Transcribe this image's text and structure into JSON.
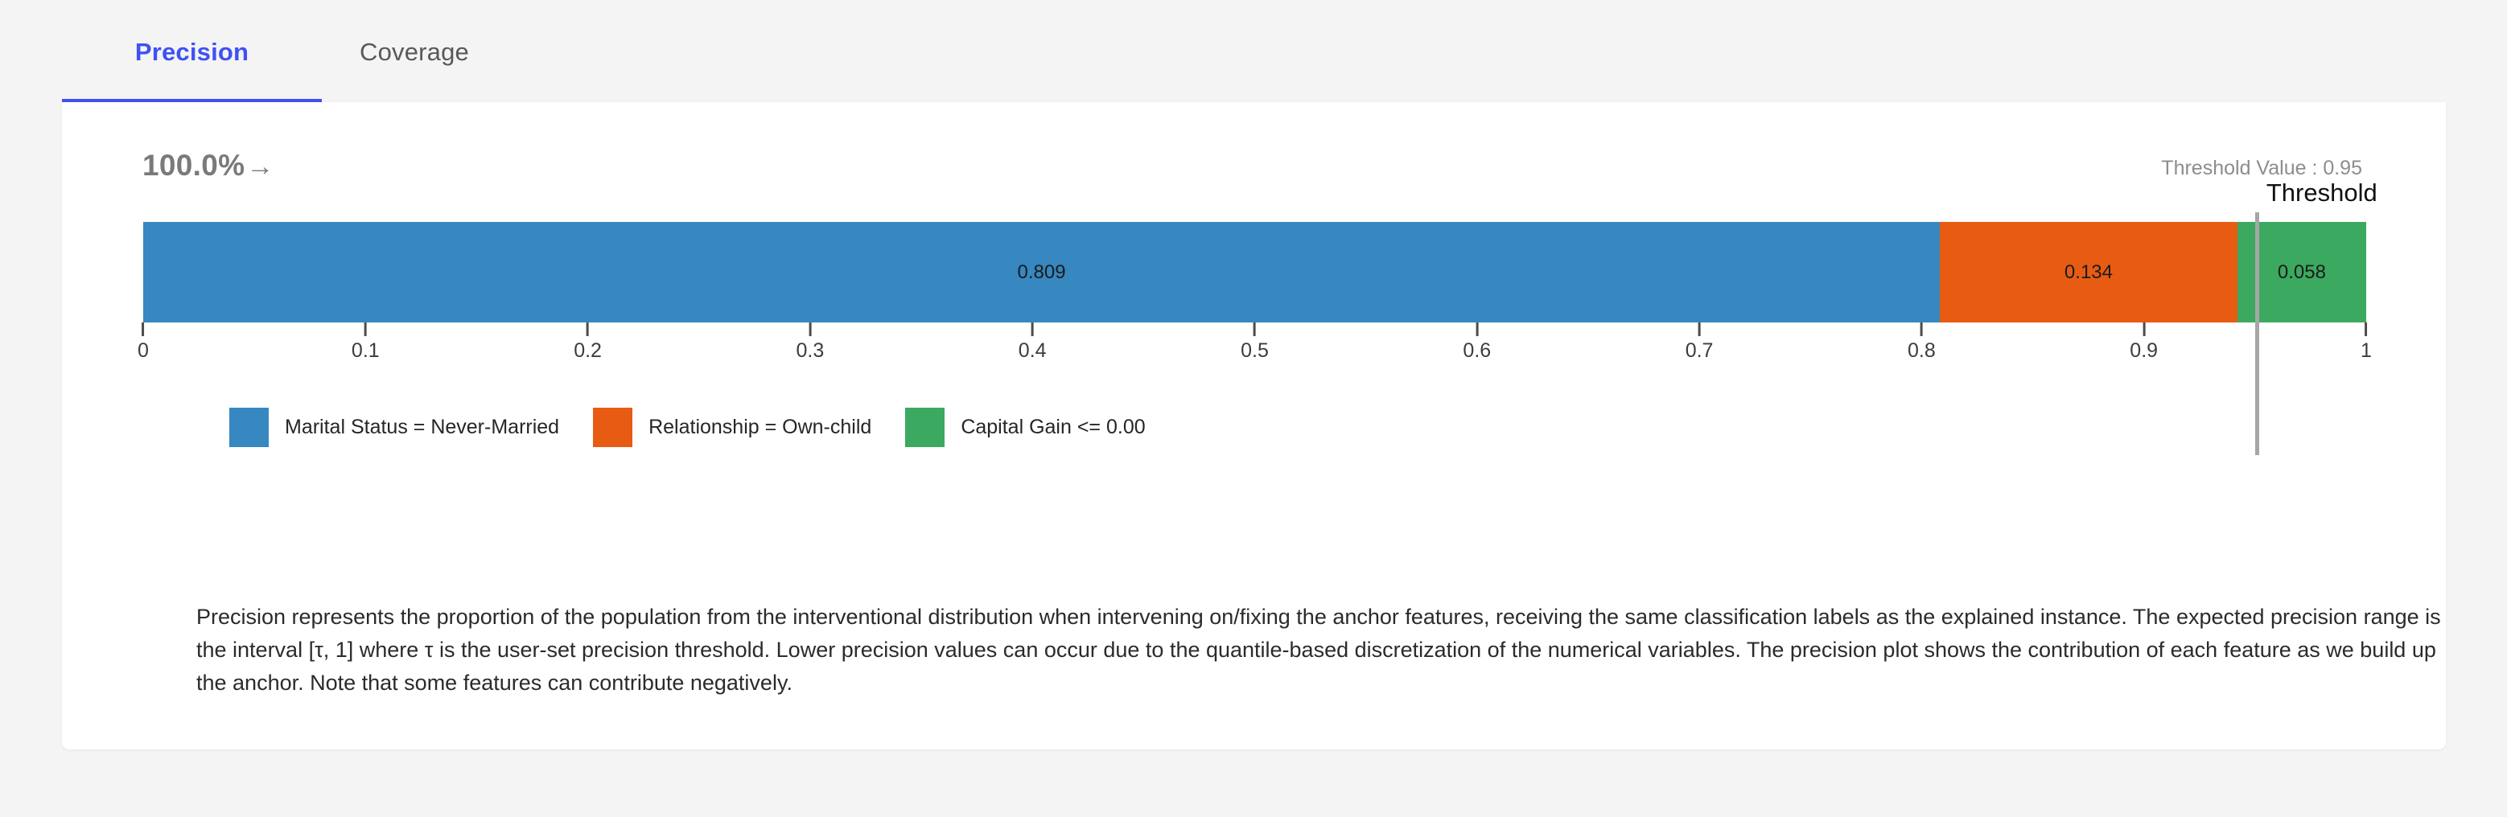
{
  "tabs": [
    {
      "label": "Precision",
      "active": true
    },
    {
      "label": "Coverage",
      "active": false
    }
  ],
  "header": {
    "percent_label": "100.0%",
    "percent_arrow": "→",
    "threshold_value_label": "Threshold Value : 0.95"
  },
  "threshold": {
    "caption": "Threshold",
    "value": 0.95,
    "line_color": "#a6a6a6"
  },
  "legend": [
    {
      "label": "Marital Status = Never-Married",
      "color": "#3787c0"
    },
    {
      "label": "Relationship = Own-child",
      "color": "#e85b13"
    },
    {
      "label": "Capital Gain <= 0.00",
      "color": "#3ca960"
    }
  ],
  "description": "Precision represents the proportion of the population from the interventional distribution when intervening on/fixing the anchor features, receiving the same classification labels as the explained instance. The expected precision range is the interval [τ, 1] where τ is the user-set precision threshold. Lower precision values can occur due to the quantile-based discretization of the numerical variables. The precision plot shows the contribution of each feature as we build up the anchor. Note that some features can contribute negatively.",
  "chart_data": {
    "type": "bar",
    "orientation": "horizontal",
    "stacked": true,
    "title": "",
    "xlabel": "",
    "ylabel": "",
    "xlim": [
      0,
      1
    ],
    "grid": false,
    "legend_position": "bottom-left",
    "categories": [
      "Precision"
    ],
    "tick_labels": [
      "0",
      "0.1",
      "0.2",
      "0.3",
      "0.4",
      "0.5",
      "0.6",
      "0.7",
      "0.8",
      "0.9",
      "1"
    ],
    "tick_values": [
      0,
      0.1,
      0.2,
      0.3,
      0.4,
      0.5,
      0.6,
      0.7,
      0.8,
      0.9,
      1
    ],
    "series": [
      {
        "name": "Marital Status = Never-Married",
        "value": 0.809,
        "label": "0.809",
        "color": "#3787c0"
      },
      {
        "name": "Relationship = Own-child",
        "value": 0.134,
        "label": "0.134",
        "color": "#e85b13"
      },
      {
        "name": "Capital Gain <= 0.00",
        "value": 0.058,
        "label": "0.058",
        "color": "#3ca960"
      }
    ],
    "annotations": [
      {
        "name": "threshold",
        "text": "Threshold",
        "x": 0.95
      }
    ],
    "total": 1.001
  }
}
